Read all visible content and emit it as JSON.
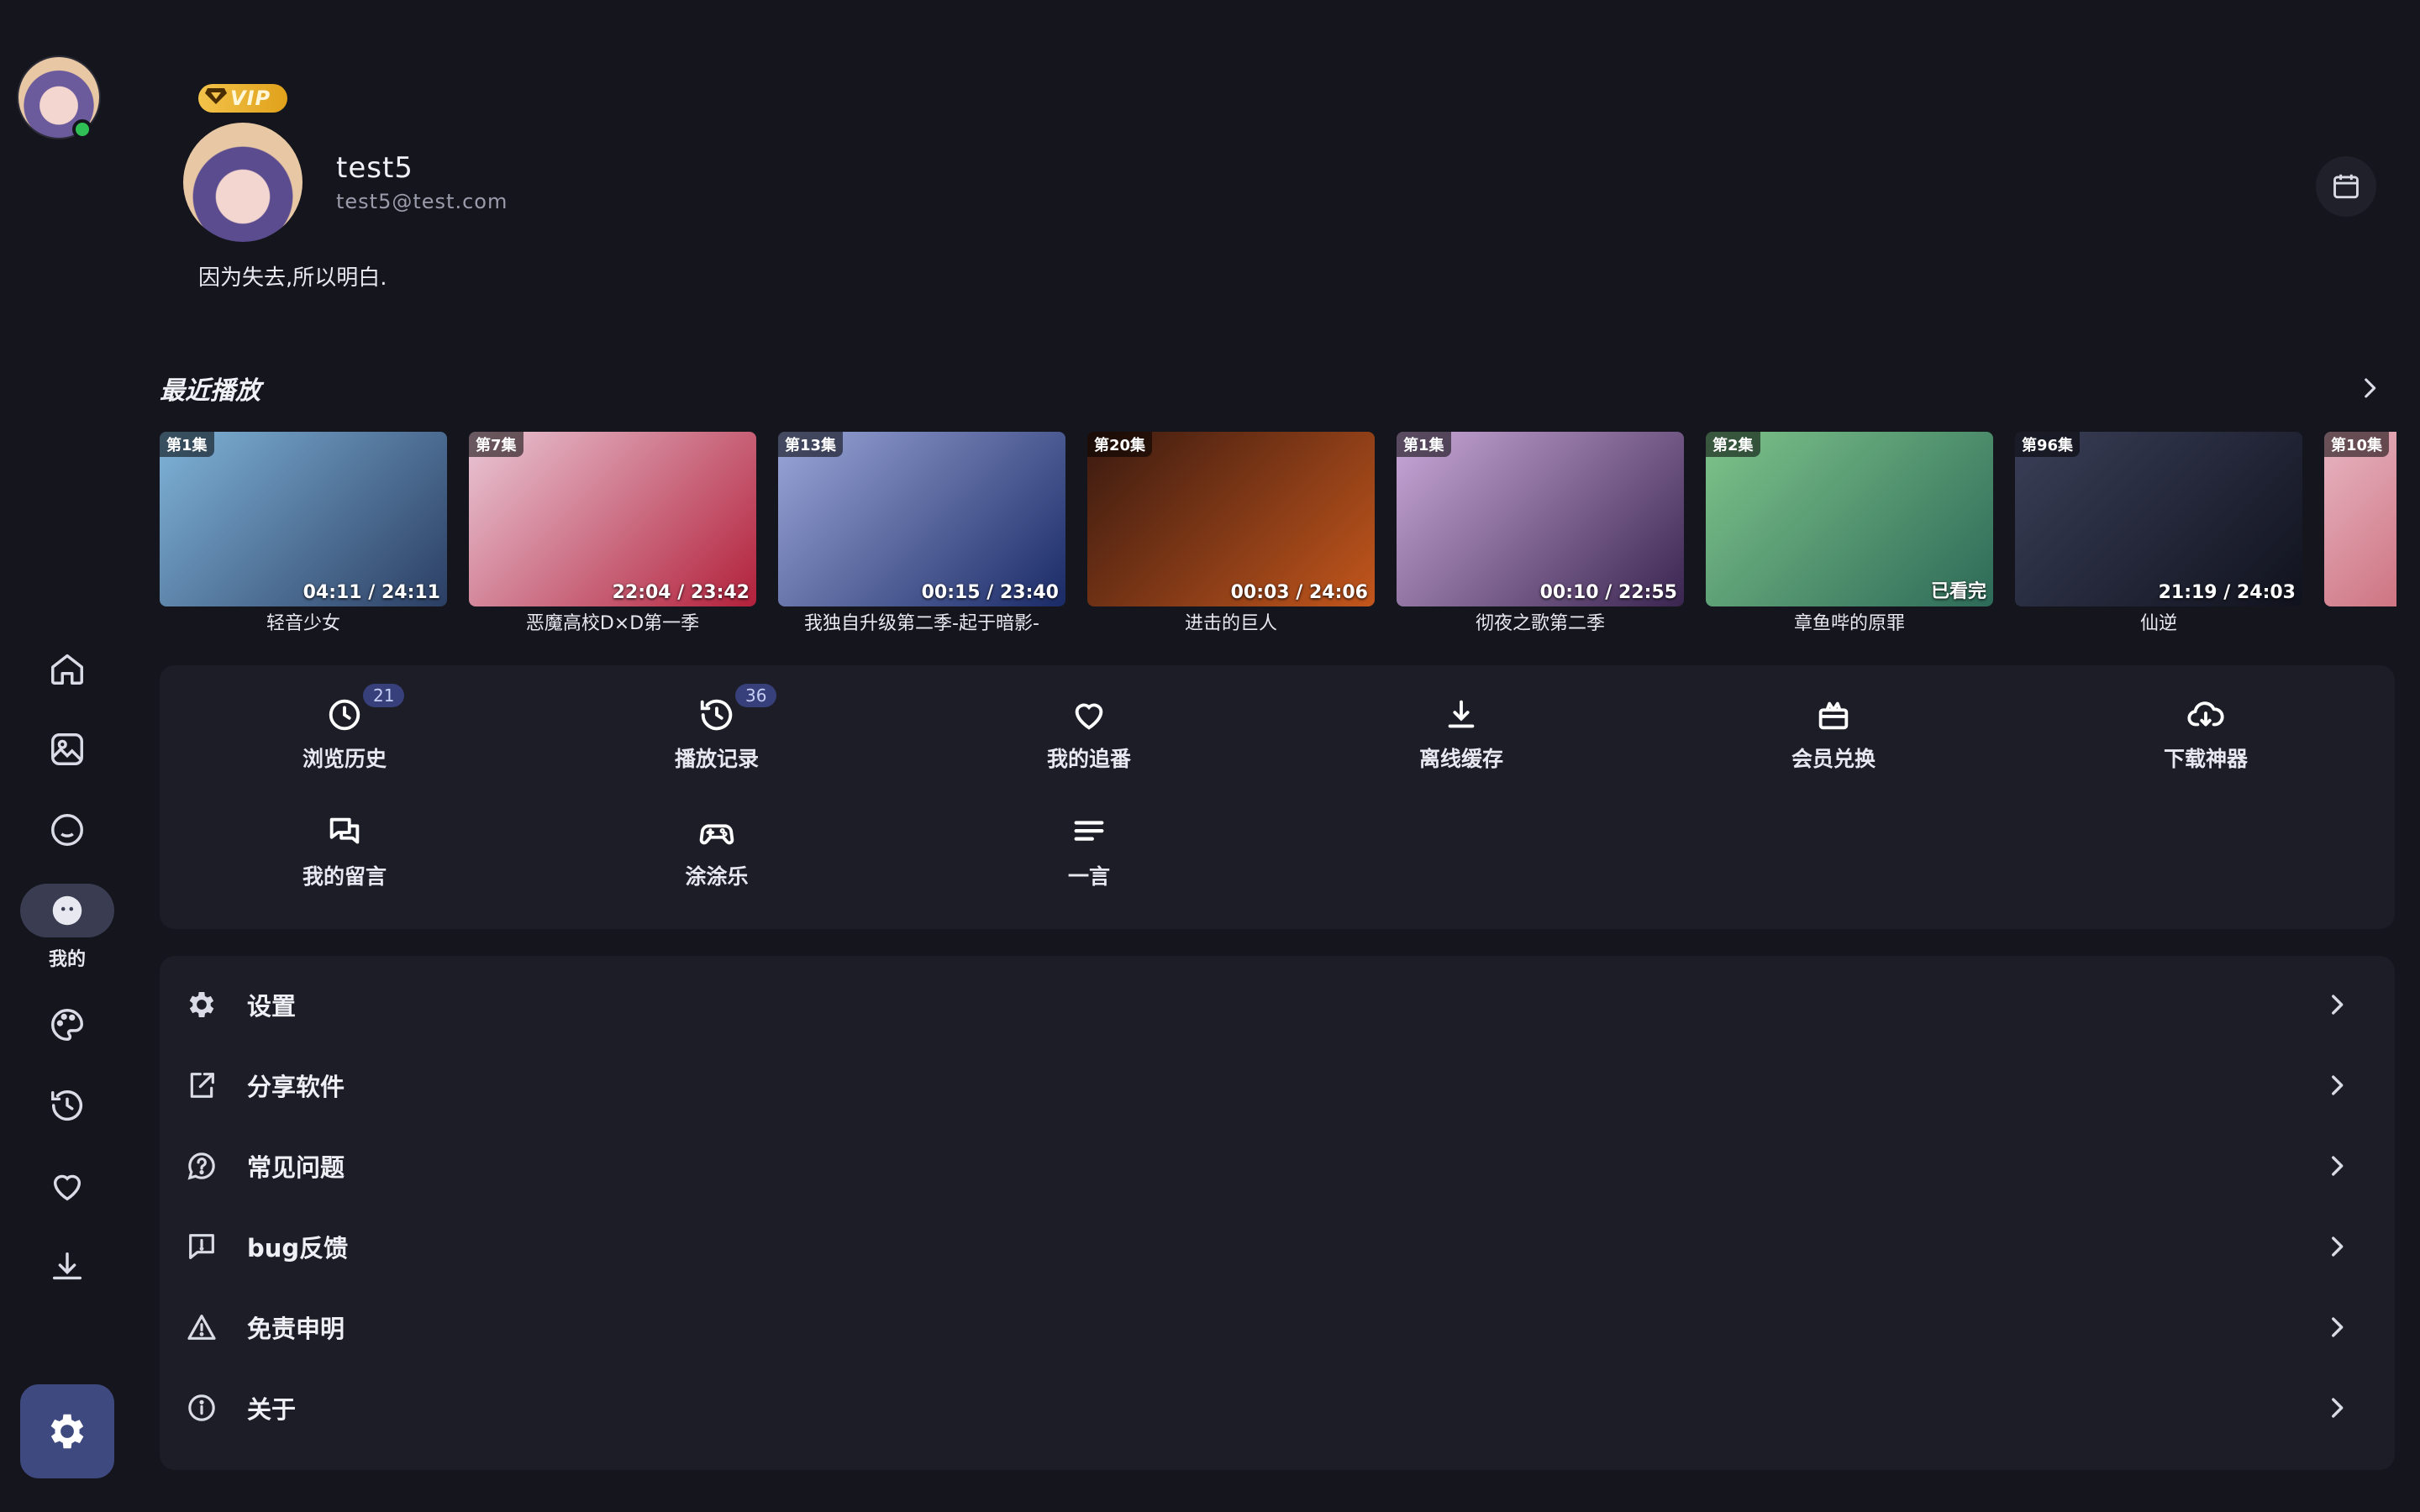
{
  "user": {
    "vip_label": "VIP",
    "name": "test5",
    "email": "test5@test.com",
    "signature": "因为失去,所以明白."
  },
  "sidebar": {
    "active_label": "我的",
    "items": [
      "home-icon",
      "image-icon",
      "smile-icon",
      "me-icon",
      "palette-icon",
      "history-icon",
      "heart-icon",
      "download-icon"
    ]
  },
  "recent": {
    "title": "最近播放",
    "items": [
      {
        "episode": "第1集",
        "progress": "04:11 / 24:11",
        "title": "轻音少女",
        "color1": "#7fb3d8",
        "color2": "#2b3e63"
      },
      {
        "episode": "第7集",
        "progress": "22:04 / 23:42",
        "title": "恶魔高校D×D第一季",
        "color1": "#e9c7d6",
        "color2": "#b2203a"
      },
      {
        "episode": "第13集",
        "progress": "00:15 / 23:40",
        "title": "我独自升级第二季-起于暗影-",
        "color1": "#9aa6d8",
        "color2": "#1a2a66"
      },
      {
        "episode": "第20集",
        "progress": "00:03 / 24:06",
        "title": "进击的巨人",
        "color1": "#3a1a10",
        "color2": "#c3561c"
      },
      {
        "episode": "第1集",
        "progress": "00:10 / 22:55",
        "title": "彻夜之歌第二季",
        "color1": "#c9a8d8",
        "color2": "#3a2550"
      },
      {
        "episode": "第2集",
        "progress": "已看完",
        "title": "章鱼哔的原罪",
        "color1": "#7ec38a",
        "color2": "#2d6a58"
      },
      {
        "episode": "第96集",
        "progress": "21:19 / 24:03",
        "title": "仙逆",
        "color1": "#3a3f58",
        "color2": "#10121d"
      },
      {
        "episode": "第10集",
        "progress": "",
        "title": "",
        "color1": "#e7b5c2",
        "color2": "#b93c4a"
      }
    ]
  },
  "quick": {
    "items": [
      {
        "label": "浏览历史",
        "badge": "21",
        "icon": "clock-icon"
      },
      {
        "label": "播放记录",
        "badge": "36",
        "icon": "history-icon"
      },
      {
        "label": "我的追番",
        "badge": "",
        "icon": "heart-icon"
      },
      {
        "label": "离线缓存",
        "badge": "",
        "icon": "download-icon"
      },
      {
        "label": "会员兑换",
        "badge": "",
        "icon": "gift-icon"
      },
      {
        "label": "下载神器",
        "badge": "",
        "icon": "cloud-download-icon"
      },
      {
        "label": "我的留言",
        "badge": "",
        "icon": "chat-icon"
      },
      {
        "label": "涂涂乐",
        "badge": "",
        "icon": "gamepad-icon"
      },
      {
        "label": "一言",
        "badge": "",
        "icon": "text-lines-icon"
      }
    ]
  },
  "menu": {
    "items": [
      {
        "label": "设置",
        "icon": "gear-icon"
      },
      {
        "label": "分享软件",
        "icon": "share-icon"
      },
      {
        "label": "常见问题",
        "icon": "help-icon"
      },
      {
        "label": "bug反馈",
        "icon": "feedback-icon"
      },
      {
        "label": "免责申明",
        "icon": "warning-icon"
      },
      {
        "label": "关于",
        "icon": "info-icon"
      }
    ]
  },
  "colors": {
    "background": "#15161d",
    "panel": "#1c1d26",
    "accent": "#3e4a7f",
    "badge": "#37407a",
    "vip": "#f3c34a",
    "online": "#2fbf55"
  }
}
